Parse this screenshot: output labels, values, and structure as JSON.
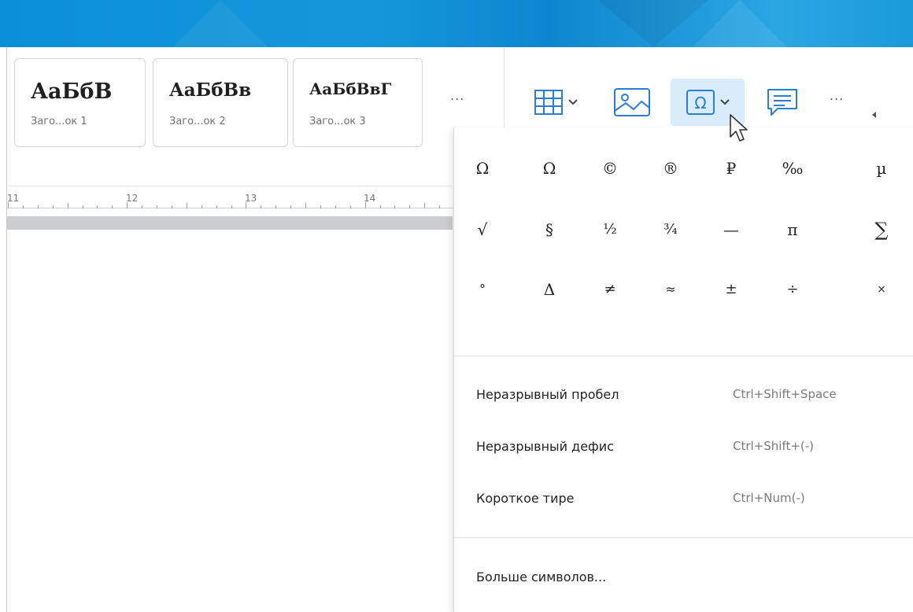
{
  "styles_gallery": [
    {
      "preview": "АаБбВ",
      "name": "Заго...ок 1"
    },
    {
      "preview": "АаБбВв",
      "name": "Заго...ок 2"
    },
    {
      "preview": "АаБбВвГ",
      "name": "Заго...ок 3"
    }
  ],
  "toolbar": {
    "more_styles": "...",
    "more_tools": "...",
    "icons": [
      "table-icon",
      "image-icon",
      "special-character-icon",
      "comment-icon"
    ],
    "active_button": "special-character"
  },
  "ruler": {
    "numbers": [
      "11",
      "12",
      "13",
      "14"
    ]
  },
  "symbol_menu": {
    "symbols": [
      [
        "Ω",
        "Ω",
        "©",
        "®",
        "₽",
        "‰",
        "µ"
      ],
      [
        "√",
        "§",
        "½",
        "¾",
        "—",
        "π",
        "∑"
      ],
      [
        "°",
        "Δ",
        "≠",
        "≈",
        "±",
        "÷",
        "×"
      ]
    ],
    "items": [
      {
        "label": "Неразрывный пробел",
        "shortcut": "Ctrl+Shift+Space"
      },
      {
        "label": "Неразрывный дефис",
        "shortcut": "Ctrl+Shift+(-)"
      },
      {
        "label": "Короткое тире",
        "shortcut": "Ctrl+Num(-)"
      }
    ],
    "more_label": "Больше символов..."
  },
  "colors": {
    "accent": "#0b8fd6",
    "active_bg": "#d9ecfb",
    "icon_blue": "#2a7fd4"
  }
}
